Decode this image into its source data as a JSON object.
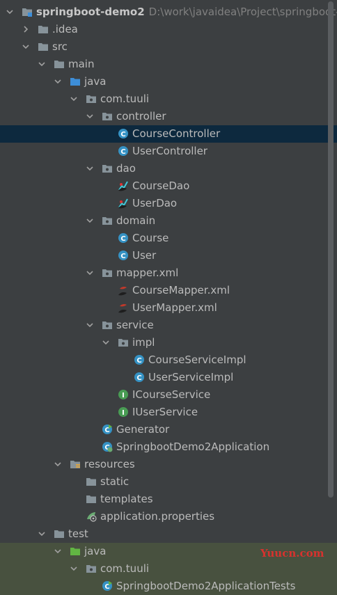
{
  "project": {
    "name": "springboot-demo2",
    "path": "D:\\work\\javaidea\\Project\\springboot-d"
  },
  "tree": [
    {
      "label": "springboot-demo2",
      "depth": 0,
      "expanded": true,
      "icon": "module-icon",
      "bold": true,
      "show_path": true
    },
    {
      "label": ".idea",
      "depth": 1,
      "expanded": false,
      "icon": "folder-icon"
    },
    {
      "label": "src",
      "depth": 1,
      "expanded": true,
      "icon": "folder-icon"
    },
    {
      "label": "main",
      "depth": 2,
      "expanded": true,
      "icon": "folder-icon"
    },
    {
      "label": "java",
      "depth": 3,
      "expanded": true,
      "icon": "source-folder-icon"
    },
    {
      "label": "com.tuuli",
      "depth": 4,
      "expanded": true,
      "icon": "package-icon"
    },
    {
      "label": "controller",
      "depth": 5,
      "expanded": true,
      "icon": "package-icon"
    },
    {
      "label": "CourseController",
      "depth": 6,
      "icon": "class-icon",
      "selected": true
    },
    {
      "label": "UserController",
      "depth": 6,
      "icon": "class-icon"
    },
    {
      "label": "dao",
      "depth": 5,
      "expanded": true,
      "icon": "package-icon"
    },
    {
      "label": "CourseDao",
      "depth": 6,
      "icon": "mybatis-icon"
    },
    {
      "label": "UserDao",
      "depth": 6,
      "icon": "mybatis-icon"
    },
    {
      "label": "domain",
      "depth": 5,
      "expanded": true,
      "icon": "package-icon"
    },
    {
      "label": "Course",
      "depth": 6,
      "icon": "class-icon"
    },
    {
      "label": "User",
      "depth": 6,
      "icon": "class-icon"
    },
    {
      "label": "mapper.xml",
      "depth": 5,
      "expanded": true,
      "icon": "package-icon"
    },
    {
      "label": "CourseMapper.xml",
      "depth": 6,
      "icon": "mybatis-xml-icon"
    },
    {
      "label": "UserMapper.xml",
      "depth": 6,
      "icon": "mybatis-xml-icon"
    },
    {
      "label": "service",
      "depth": 5,
      "expanded": true,
      "icon": "package-icon"
    },
    {
      "label": "impl",
      "depth": 6,
      "expanded": true,
      "icon": "package-icon"
    },
    {
      "label": "CourseServiceImpl",
      "depth": 7,
      "icon": "class-icon"
    },
    {
      "label": "UserServiceImpl",
      "depth": 7,
      "icon": "class-icon"
    },
    {
      "label": "ICourseService",
      "depth": 6,
      "icon": "interface-icon"
    },
    {
      "label": "IUserService",
      "depth": 6,
      "icon": "interface-icon"
    },
    {
      "label": "Generator",
      "depth": 5,
      "icon": "main-class-icon"
    },
    {
      "label": "SpringbootDemo2Application",
      "depth": 5,
      "icon": "spring-boot-class-icon"
    },
    {
      "label": "resources",
      "depth": 3,
      "expanded": true,
      "icon": "resources-folder-icon"
    },
    {
      "label": "static",
      "depth": 4,
      "icon": "folder-icon"
    },
    {
      "label": "templates",
      "depth": 4,
      "icon": "folder-icon"
    },
    {
      "label": "application.properties",
      "depth": 4,
      "icon": "spring-properties-icon"
    },
    {
      "label": "test",
      "depth": 2,
      "expanded": true,
      "icon": "folder-icon"
    },
    {
      "label": "java",
      "depth": 3,
      "expanded": true,
      "icon": "test-source-folder-icon",
      "test": true
    },
    {
      "label": "com.tuuli",
      "depth": 4,
      "expanded": true,
      "icon": "package-icon",
      "test": true
    },
    {
      "label": "SpringbootDemo2ApplicationTests",
      "depth": 5,
      "icon": "spring-boot-test-icon",
      "test": true
    }
  ],
  "watermark": "Yuucn.com",
  "colors": {
    "background": "#3c3f41",
    "selected": "#0d293e",
    "test_background": "#48513f",
    "class": "#3592c4",
    "interface": "#499c54",
    "folder": "#87939a",
    "source_folder": "#3d8ed8",
    "test_folder": "#62b543"
  }
}
